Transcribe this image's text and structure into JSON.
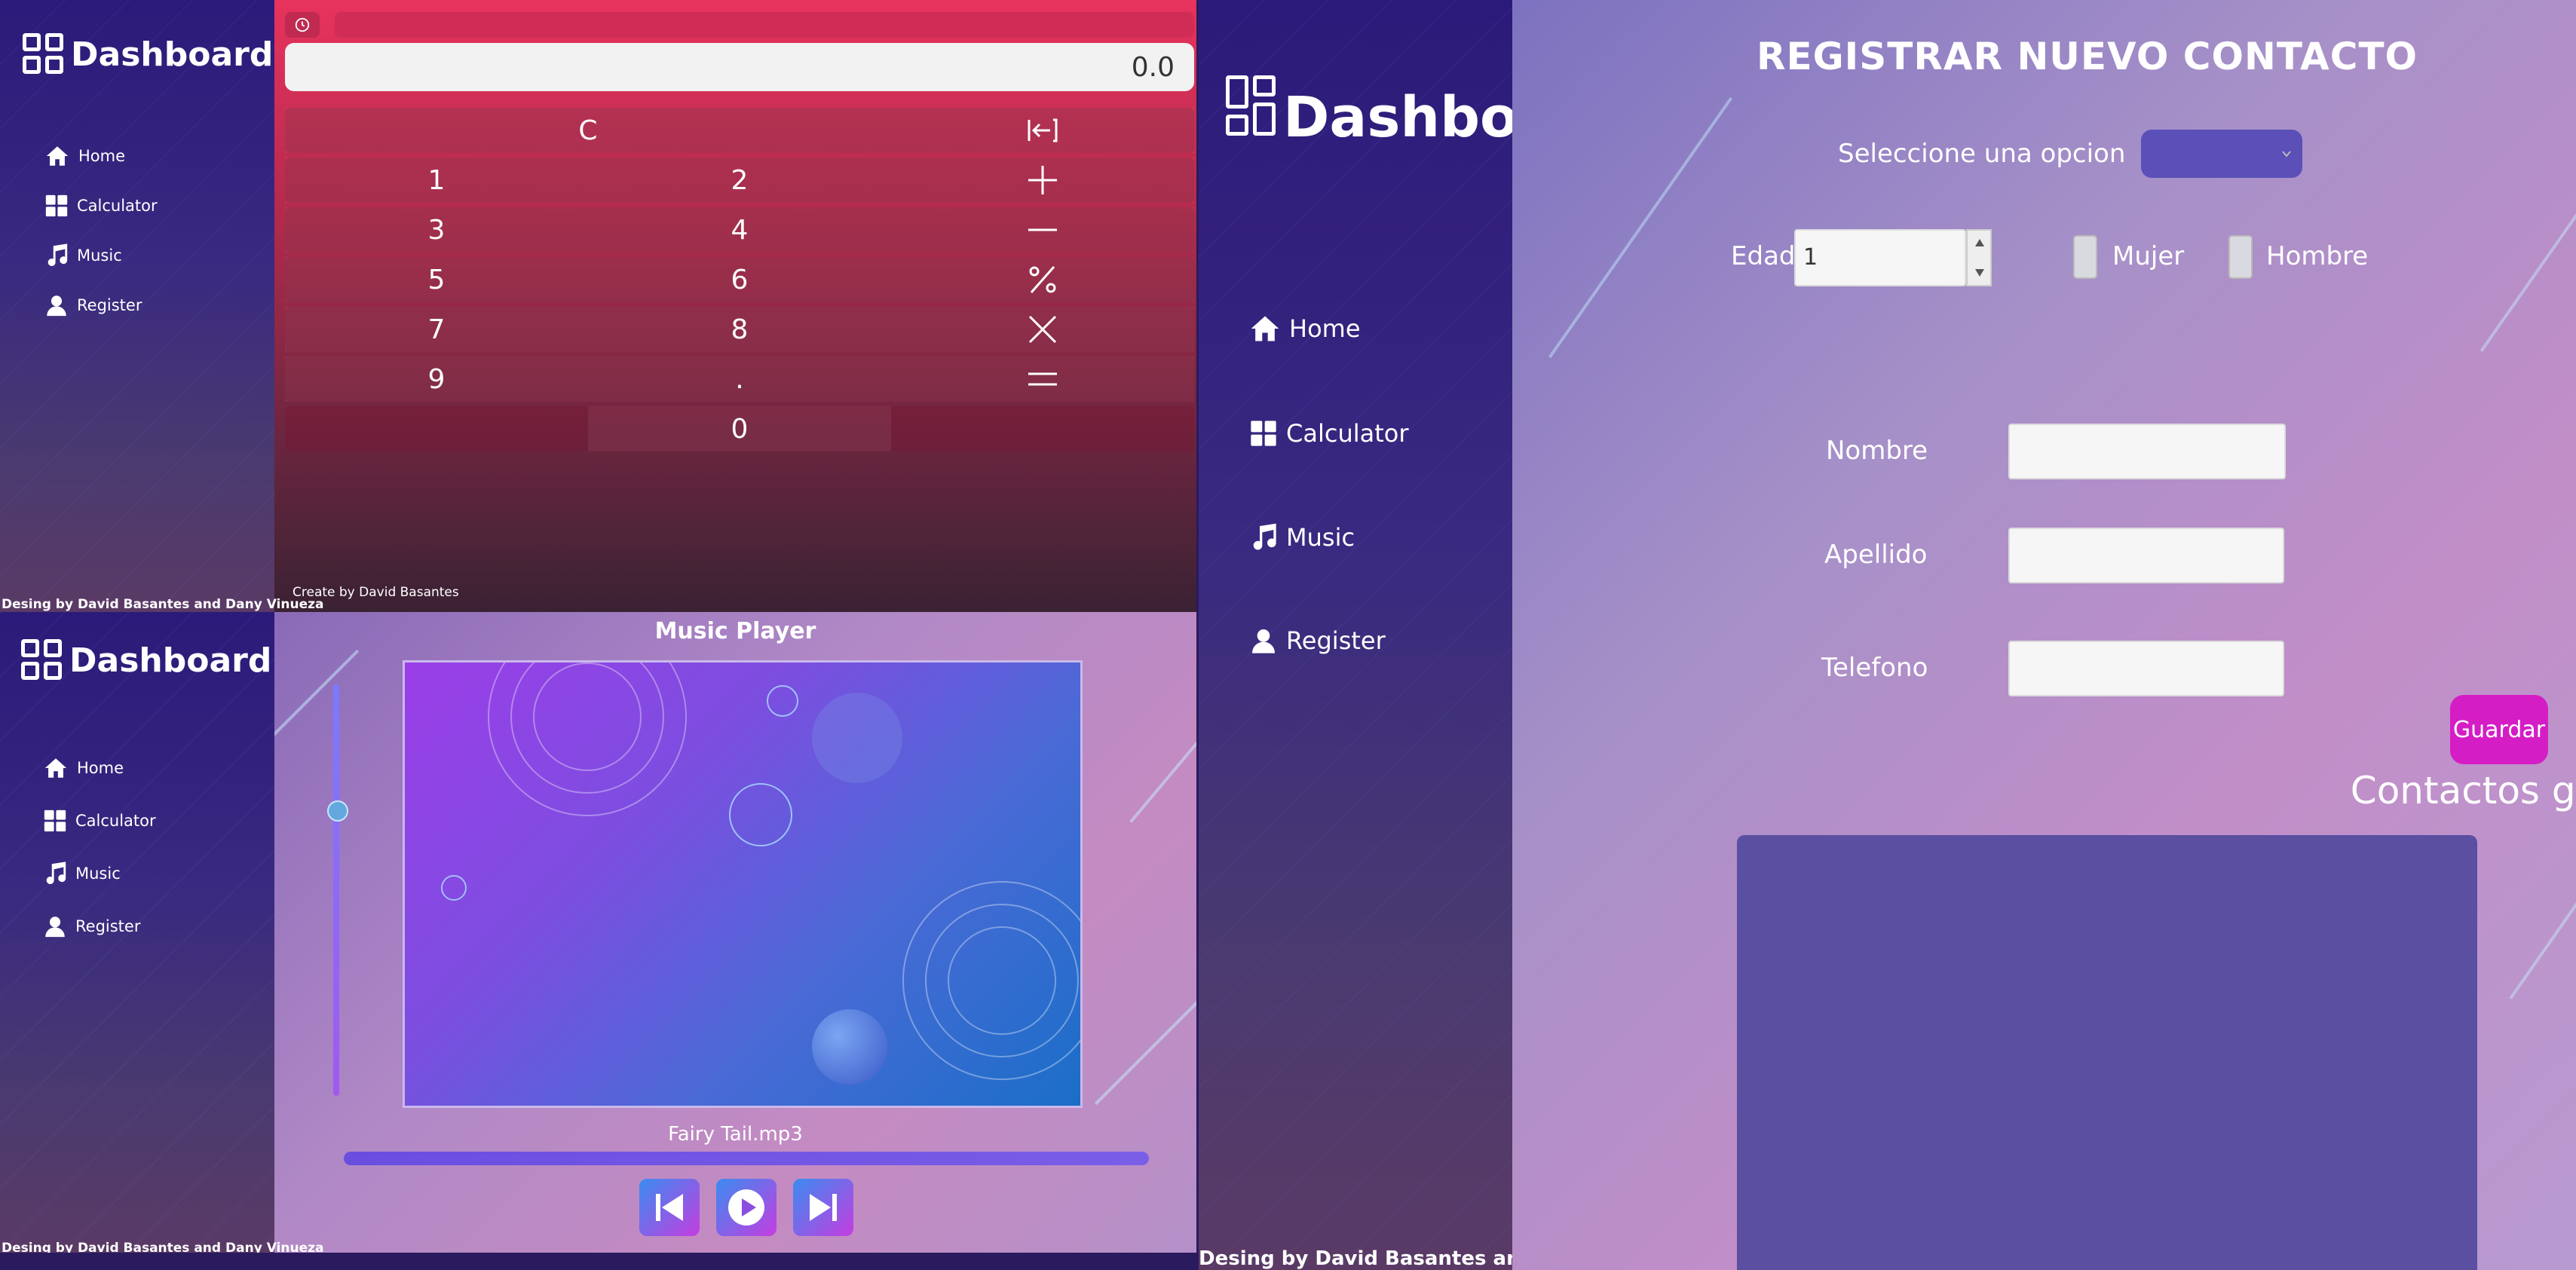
{
  "brand": "Dashboard",
  "nav": {
    "home": "Home",
    "calculator": "Calculator",
    "music": "Music",
    "register": "Register"
  },
  "footer_credit": "Desing by David Basantes and Dany Vinueza",
  "calculator": {
    "display": "0.0",
    "keys": {
      "clear": "C",
      "k1": "1",
      "k2": "2",
      "k3": "3",
      "k4": "4",
      "k5": "5",
      "k6": "6",
      "k7": "7",
      "k8": "8",
      "k9": "9",
      "k0": "0",
      "dot": "."
    },
    "credit": "Create by David Basantes"
  },
  "music": {
    "title": "Music Player",
    "song": "Fairy Tail.mp3"
  },
  "register": {
    "title": "REGISTRAR NUEVO CONTACTO",
    "select_label": "Seleccione una opcion",
    "edad_label": "Edad",
    "edad_value": "1",
    "mujer": "Mujer",
    "hombre": "Hombre",
    "nombre": "Nombre",
    "apellido": "Apellido",
    "telefono": "Telefono",
    "guardar": "Guardar",
    "saved_title": "Contactos guardados:"
  },
  "colors": {
    "calc_top": "#e8335e",
    "sidebar": "#2c1a7a",
    "guardar": "#d51dc6",
    "saved_box": "#5a4fa0"
  }
}
